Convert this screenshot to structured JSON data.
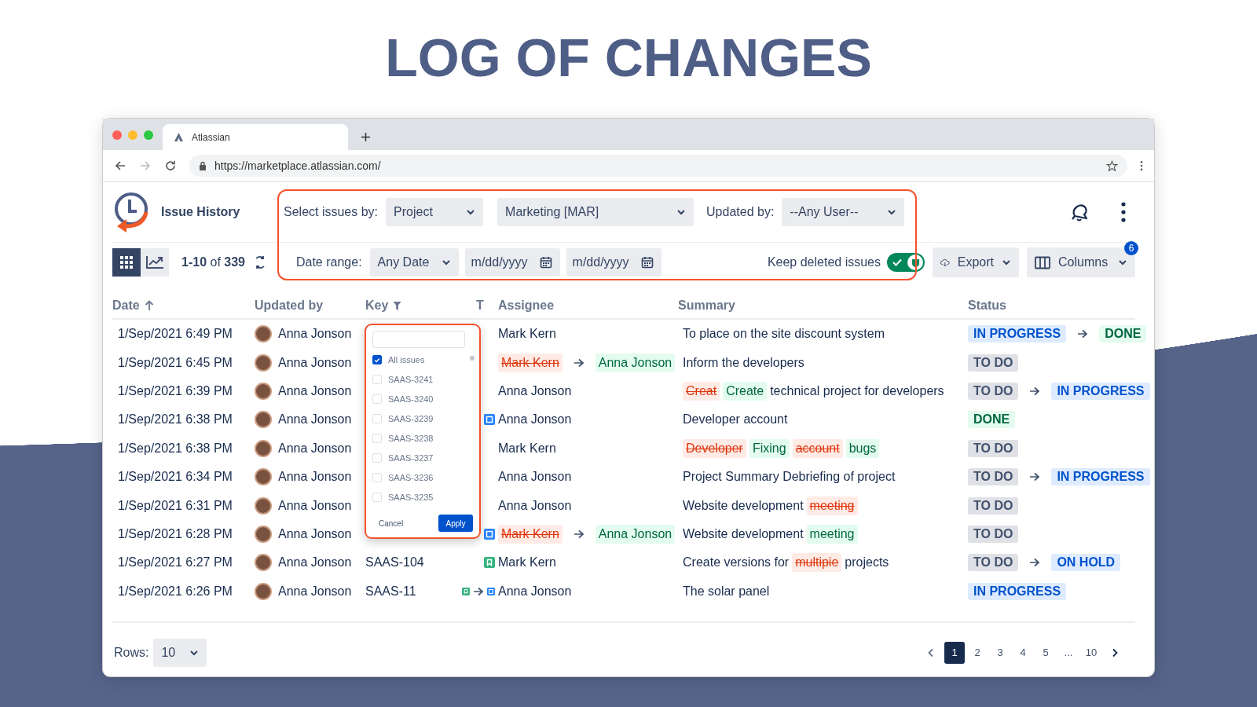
{
  "heading": "LOG OF CHANGES",
  "browser": {
    "tab_title": "Atlassian",
    "url": "https://marketplace.atlassian.com/"
  },
  "app": {
    "title": "Issue History"
  },
  "filters": {
    "select_by_label": "Select issues by:",
    "select_by": "Project",
    "project": "Marketing [MAR]",
    "updated_by_label": "Updated by:",
    "updated_by": "--Any User--",
    "date_range_label": "Date range:",
    "date_range": "Any Date",
    "date_from_placeholder": "m/dd/yyyy",
    "date_to_placeholder": "m/dd/yyyy",
    "keep_deleted_label": "Keep deleted issues",
    "keep_deleted_on": true
  },
  "toolbar": {
    "views": [
      {
        "kind": "grid",
        "selected": true
      },
      {
        "kind": "chart",
        "selected": false
      }
    ],
    "count": "**1-10** of **339**",
    "export": "Export",
    "columns": "Columns",
    "columns_badge": "6"
  },
  "table": {
    "columns": [
      "Date",
      "Updated by",
      "Key",
      "T",
      "Assignee",
      "Summary",
      "Status"
    ],
    "rows": [
      {
        "date": "1/Sep/2021 6:49 PM",
        "user": "Anna Jonson",
        "assignee": {
          "kind": "plain",
          "name": "Mark Kern"
        },
        "summary": [
          {
            "kind": "plain",
            "text": "To place on the site discount system"
          }
        ],
        "status": [
          {
            "kind": "progress",
            "label": "IN PROGRESS"
          },
          {
            "kind": "done",
            "label": "DONE"
          }
        ]
      },
      {
        "date": "1/Sep/2021 6:45 PM",
        "user": "Anna Jonson",
        "assignee": {
          "kind": "change",
          "from": "Mark Kern",
          "to": "Anna Jonson"
        },
        "summary": [
          {
            "kind": "plain",
            "text": "Inform the developers"
          }
        ],
        "status": [
          {
            "kind": "todo",
            "label": "TO DO"
          }
        ]
      },
      {
        "date": "1/Sep/2021 6:39 PM",
        "user": "Anna Jonson",
        "assignee": {
          "kind": "plain",
          "name": "Anna Jonson"
        },
        "summary": [
          {
            "kind": "removed",
            "text": "Creat"
          },
          {
            "kind": "added",
            "text": "Create"
          },
          {
            "kind": "plain",
            "text": "technical project for developers"
          }
        ],
        "status": [
          {
            "kind": "todo",
            "label": "TO DO"
          },
          {
            "kind": "progress",
            "label": "IN PROGRESS"
          }
        ]
      },
      {
        "date": "1/Sep/2021 6:38 PM",
        "user": "Anna Jonson",
        "types": [
          {
            "kind": "task"
          }
        ],
        "assignee": {
          "kind": "plain",
          "name": "Anna Jonson"
        },
        "summary": [
          {
            "kind": "plain",
            "text": "Developer account"
          }
        ],
        "status": [
          {
            "kind": "done",
            "label": "DONE"
          }
        ]
      },
      {
        "date": "1/Sep/2021 6:38 PM",
        "user": "Anna Jonson",
        "assignee": {
          "kind": "plain",
          "name": "Mark Kern"
        },
        "summary": [
          {
            "kind": "removed",
            "text": "Developer"
          },
          {
            "kind": "added",
            "text": "Fixing"
          },
          {
            "kind": "removed",
            "text": "account"
          },
          {
            "kind": "added",
            "text": "bugs"
          }
        ],
        "status": [
          {
            "kind": "todo",
            "label": "TO DO"
          }
        ]
      },
      {
        "date": "1/Sep/2021 6:34 PM",
        "user": "Anna Jonson",
        "assignee": {
          "kind": "plain",
          "name": "Anna Jonson"
        },
        "summary": [
          {
            "kind": "plain",
            "text": "Project Summary Debriefing of project"
          }
        ],
        "status": [
          {
            "kind": "todo",
            "label": "TO DO"
          },
          {
            "kind": "progress",
            "label": "IN PROGRESS"
          }
        ]
      },
      {
        "date": "1/Sep/2021 6:31 PM",
        "user": "Anna Jonson",
        "assignee": {
          "kind": "plain",
          "name": "Anna Jonson"
        },
        "summary": [
          {
            "kind": "plain",
            "text": "Website development"
          },
          {
            "kind": "removed",
            "text": "meeting"
          }
        ],
        "status": [
          {
            "kind": "todo",
            "label": "TO DO"
          }
        ]
      },
      {
        "date": "1/Sep/2021 6:28 PM",
        "user": "Anna Jonson",
        "types": [
          {
            "kind": "task"
          }
        ],
        "assignee": {
          "kind": "change",
          "from": "Mark Kern",
          "to": "Anna Jonson"
        },
        "summary": [
          {
            "kind": "plain",
            "text": "Website development"
          },
          {
            "kind": "added",
            "text": "meeting"
          }
        ],
        "status": [
          {
            "kind": "todo",
            "label": "TO DO"
          }
        ]
      },
      {
        "date": "1/Sep/2021 6:27 PM",
        "user": "Anna Jonson",
        "key": "SAAS-104",
        "types": [
          {
            "kind": "story"
          }
        ],
        "assignee": {
          "kind": "plain",
          "name": "Mark Kern"
        },
        "summary": [
          {
            "kind": "plain",
            "text": "Create versions for"
          },
          {
            "kind": "removed",
            "text": "multipie"
          },
          {
            "kind": "plain",
            "text": "projects"
          }
        ],
        "status": [
          {
            "kind": "todo",
            "label": "TO DO"
          },
          {
            "kind": "hold",
            "label": "ON HOLD"
          }
        ]
      },
      {
        "date": "1/Sep/2021 6:26 PM",
        "user": "Anna Jonson",
        "key": "SAAS-11",
        "types": [
          {
            "kind": "story"
          },
          {
            "kind": "task"
          }
        ],
        "assignee": {
          "kind": "plain",
          "name": "Anna Jonson"
        },
        "summary": [
          {
            "kind": "plain",
            "text": "The solar panel"
          }
        ],
        "status": [
          {
            "kind": "progress",
            "label": "IN PROGRESS"
          }
        ]
      }
    ]
  },
  "key_filter": {
    "items": [
      {
        "label": "All issues",
        "checked": true
      },
      {
        "label": "SAAS-3241",
        "checked": false
      },
      {
        "label": "SAAS-3240",
        "checked": false
      },
      {
        "label": "SAAS-3239",
        "checked": false
      },
      {
        "label": "SAAS-3238",
        "checked": false
      },
      {
        "label": "SAAS-3237",
        "checked": false
      },
      {
        "label": "SAAS-3236",
        "checked": false
      },
      {
        "label": "SAAS-3235",
        "checked": false
      }
    ],
    "cancel": "Cancel",
    "apply": "Apply"
  },
  "footer": {
    "rows_label": "Rows:",
    "rows_value": "10",
    "pages": [
      {
        "label": "1",
        "selected": true
      },
      {
        "label": "2",
        "selected": false
      },
      {
        "label": "3",
        "selected": false
      },
      {
        "label": "4",
        "selected": false
      },
      {
        "label": "5",
        "selected": false
      },
      {
        "label": "...",
        "selected": false
      },
      {
        "label": "10",
        "selected": false
      }
    ]
  }
}
